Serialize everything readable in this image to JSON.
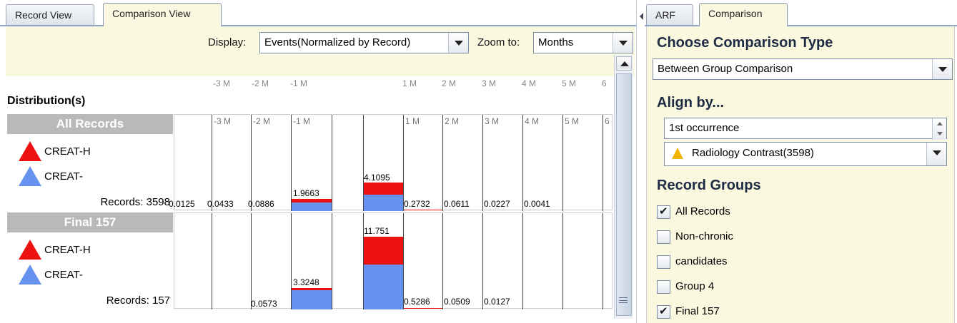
{
  "left_tabs": [
    {
      "label": "Record View",
      "active": false
    },
    {
      "label": "Comparison View",
      "active": true
    }
  ],
  "toolbar": {
    "display_label": "Display:",
    "display_value": "Events(Normalized by Record)",
    "zoom_label": "Zoom to:",
    "zoom_value": "Months"
  },
  "axis_top_ticks": [
    "-3 M",
    "-2 M",
    "-1 M",
    "1 M",
    "2 M",
    "3 M",
    "4 M",
    "5 M",
    "6"
  ],
  "distribution_title": "Distribution(s)",
  "groups": [
    {
      "name": "All Records",
      "legend": [
        {
          "label": "CREAT-H",
          "color": "#ee1111"
        },
        {
          "label": "CREAT-",
          "color": "#6693f0"
        }
      ],
      "records_text": "Records: 3598",
      "ticks": [
        "-3 M",
        "-2 M",
        "-1 M",
        "1 M",
        "2 M",
        "3 M",
        "4 M",
        "5 M",
        "6"
      ],
      "values": [
        "0.0125",
        "0.0433",
        "0.0886",
        "1.9663",
        "4.1095",
        "0.2732",
        "0.0611",
        "0.0227",
        "0.0041"
      ]
    },
    {
      "name": "Final 157",
      "legend": [
        {
          "label": "CREAT-H",
          "color": "#ee1111"
        },
        {
          "label": "CREAT-",
          "color": "#6693f0"
        }
      ],
      "records_text": "Records: 157",
      "values": [
        "0.0573",
        "3.3248",
        "11.751",
        "0.5286",
        "0.0509",
        "0.0127"
      ]
    }
  ],
  "right_tabs": [
    {
      "label": "ARF",
      "active": false
    },
    {
      "label": "Comparison",
      "active": true
    }
  ],
  "comparison": {
    "title": "Choose Comparison Type",
    "type_value": "Between Group Comparison",
    "align_title": "Align by...",
    "occurrence_value": "1st occurrence",
    "align_event": "Radiology Contrast(3598)",
    "groups_title": "Record Groups",
    "record_groups": [
      {
        "label": "All Records",
        "checked": true
      },
      {
        "label": "Non-chronic",
        "checked": false
      },
      {
        "label": "candidates",
        "checked": false
      },
      {
        "label": "Group 4",
        "checked": false
      },
      {
        "label": "Final 157",
        "checked": true
      }
    ]
  },
  "colors": {
    "creat_h": "#ee1111",
    "creat": "#6693f0",
    "panel_bg": "#fbf8e0"
  }
}
